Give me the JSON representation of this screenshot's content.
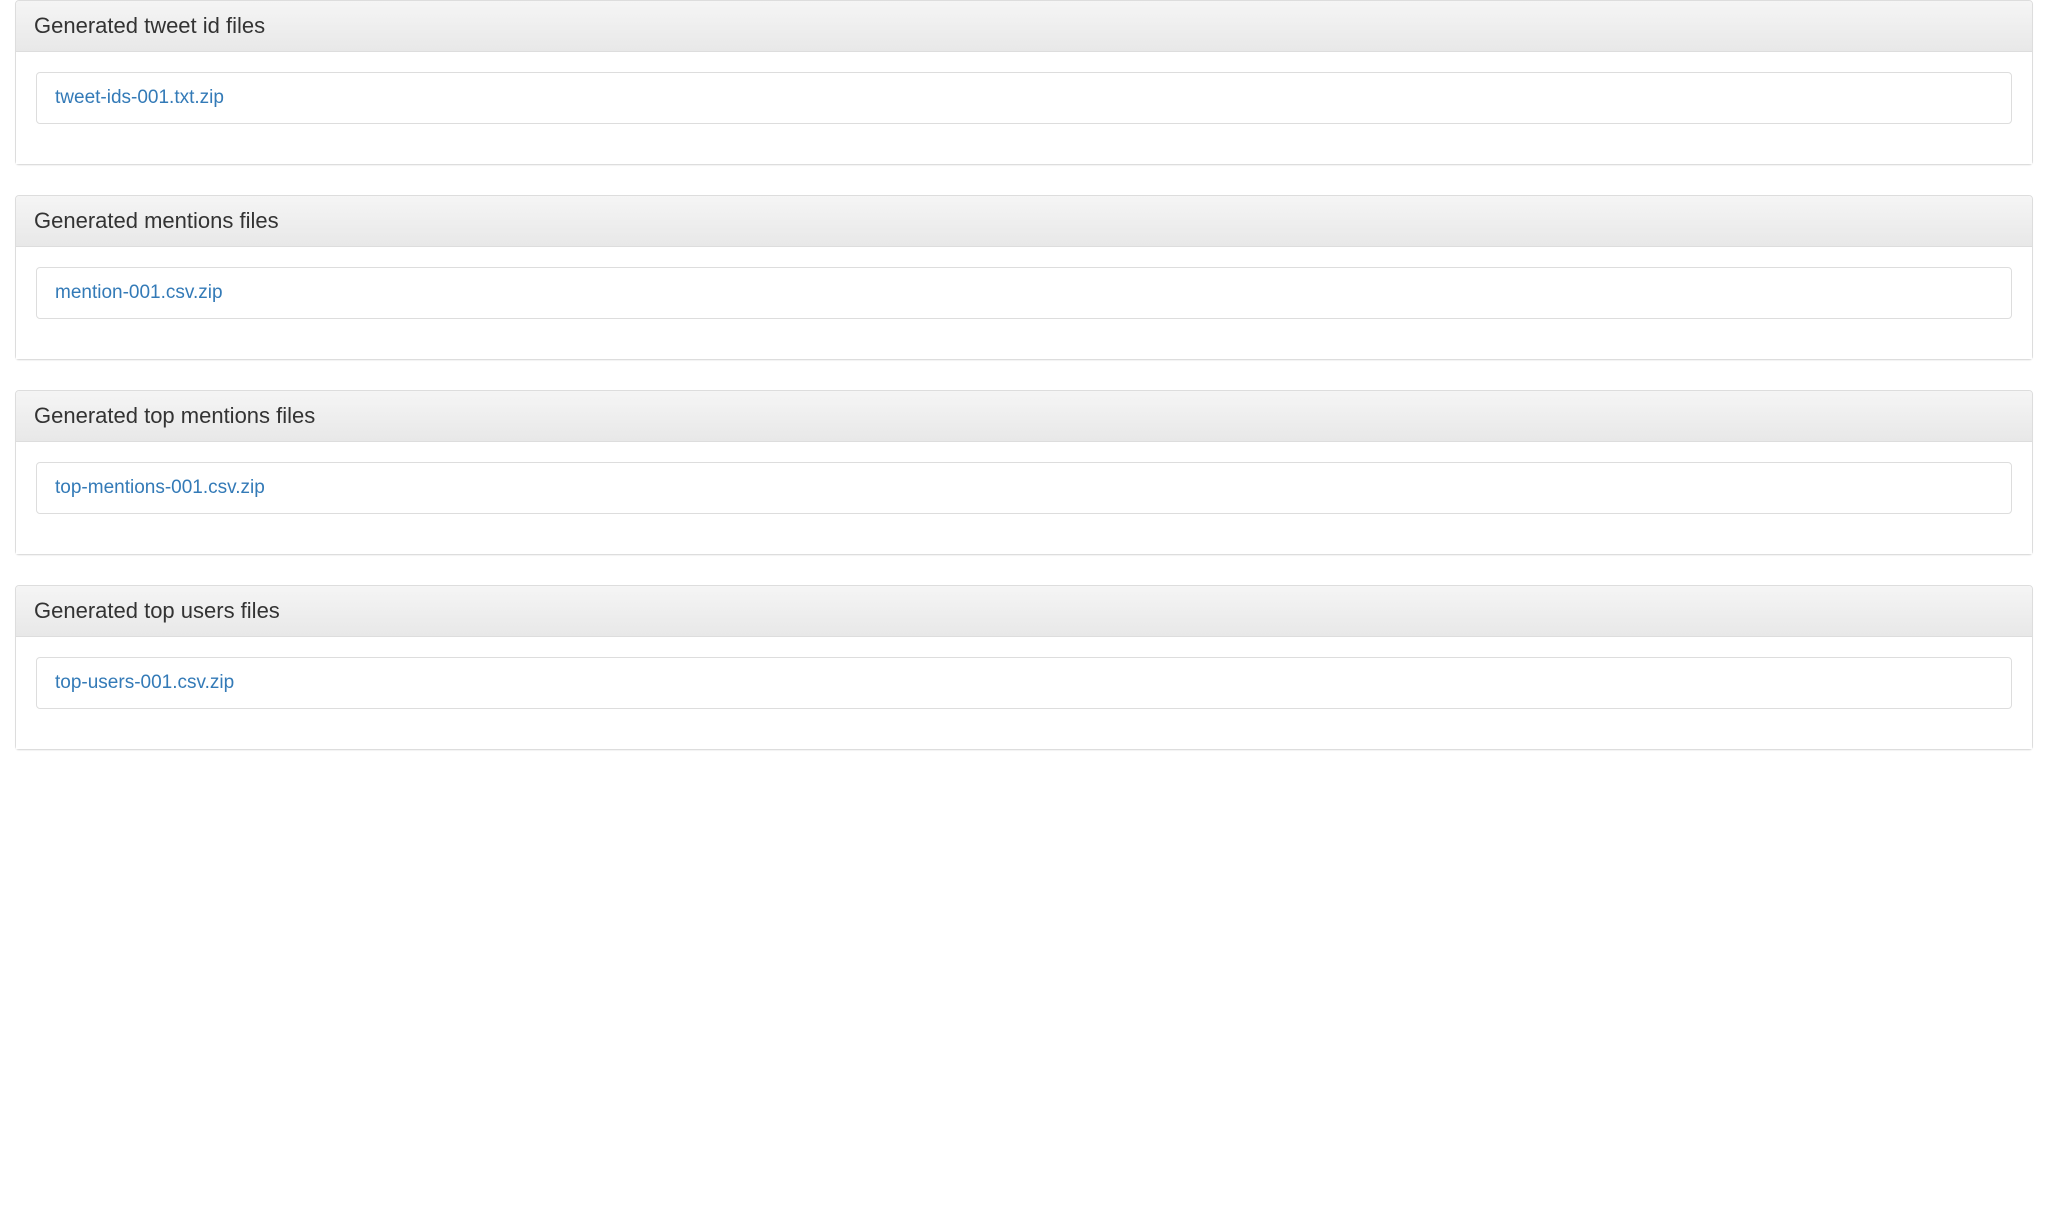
{
  "panels": [
    {
      "title": "Generated tweet id files",
      "files": [
        "tweet-ids-001.txt.zip"
      ]
    },
    {
      "title": "Generated mentions files",
      "files": [
        "mention-001.csv.zip"
      ]
    },
    {
      "title": "Generated top mentions files",
      "files": [
        "top-mentions-001.csv.zip"
      ]
    },
    {
      "title": "Generated top users files",
      "files": [
        "top-users-001.csv.zip"
      ]
    }
  ]
}
